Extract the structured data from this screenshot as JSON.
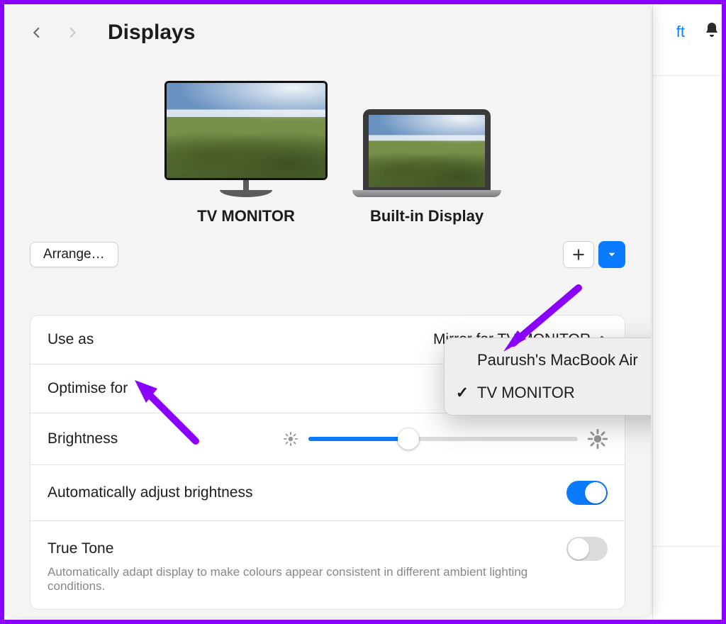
{
  "header": {
    "title": "Displays"
  },
  "sidebar_fragment": {
    "text": "ft"
  },
  "displays": {
    "external_label": "TV MONITOR",
    "builtin_label": "Built-in Display"
  },
  "toolbar": {
    "arrange_label": "Arrange…"
  },
  "rows": {
    "use_as_label": "Use as",
    "use_as_value": "Mirror for TV MONITOR",
    "optimise_label": "Optimise for",
    "brightness_label": "Brightness",
    "brightness_value_pct": 37,
    "auto_brightness_label": "Automatically adjust brightness",
    "auto_brightness_on": true,
    "true_tone_label": "True Tone",
    "true_tone_on": false,
    "true_tone_desc": "Automatically adapt display to make colours appear consistent in different ambient lighting conditions."
  },
  "popup": {
    "options": [
      "Paurush's MacBook Air",
      "TV MONITOR"
    ],
    "selected_index": 1
  }
}
